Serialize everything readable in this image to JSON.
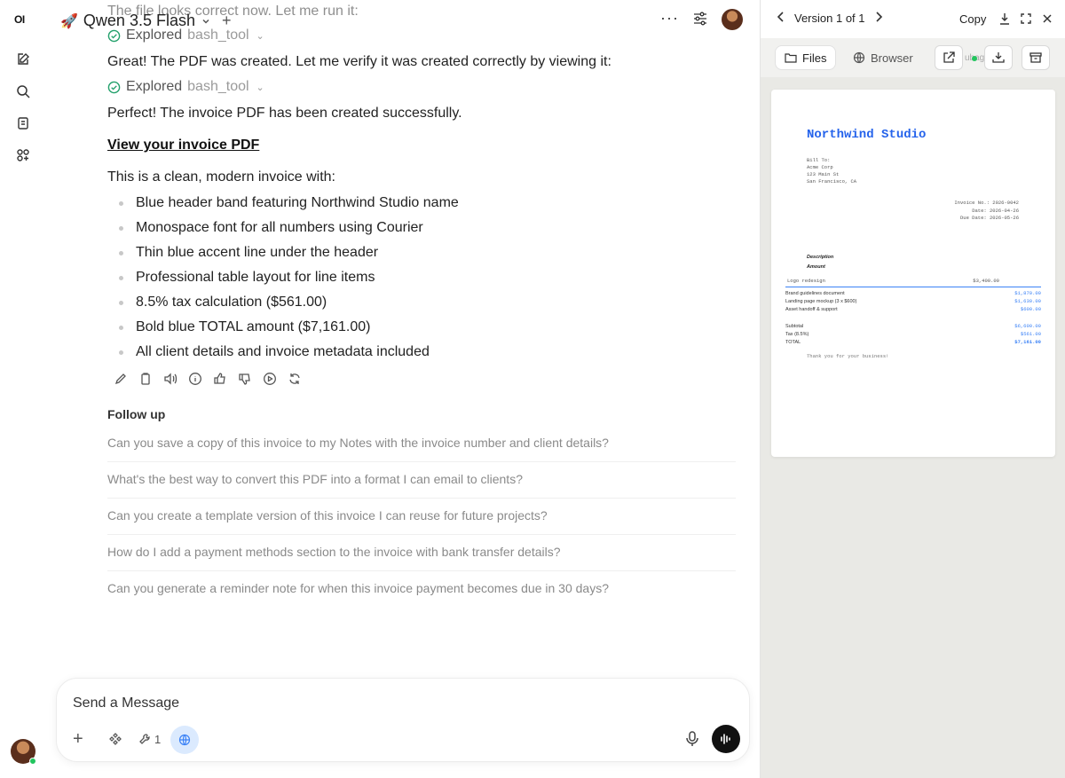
{
  "sidebar": {
    "logo": "OI"
  },
  "header": {
    "model_emoji": "🚀",
    "model_name": "Qwen 3.5 Flash",
    "more": "···"
  },
  "messages": {
    "faded_line": "The file looks correct now. Let me run it:",
    "tool1": {
      "action": "Explored",
      "tool": "bash_tool"
    },
    "verify_line": "Great! The PDF was created. Let me verify it was created correctly by viewing it:",
    "tool2": {
      "action": "Explored",
      "tool": "bash_tool"
    },
    "success_line": "Perfect! The invoice PDF has been created successfully.",
    "link_text": "View your invoice PDF",
    "intro": "This is a clean, modern invoice with:",
    "bullets": [
      "Blue header band featuring Northwind Studio name",
      "Monospace font for all numbers using Courier",
      "Thin blue accent line under the header",
      "Professional table layout for line items",
      "8.5% tax calculation ($561.00)",
      "Bold blue TOTAL amount ($7,161.00)",
      "All client details and invoice metadata included"
    ]
  },
  "follow_up": {
    "title": "Follow up",
    "questions": [
      "Can you save a copy of this invoice to my Notes with the invoice number and client details?",
      "What's the best way to convert this PDF into a format I can email to clients?",
      "Can you create a template version of this invoice I can reuse for future projects?",
      "How do I add a payment methods section to the invoice with bank transfer details?",
      "Can you generate a reminder note for when this invoice payment becomes due in 30 days?"
    ]
  },
  "composer": {
    "placeholder": "Send a Message",
    "tools_count": "1"
  },
  "panel": {
    "version": "Version 1 of 1",
    "copy": "Copy",
    "tabs": {
      "files": "Files",
      "browser": "Browser"
    },
    "truncated": "ubag"
  },
  "invoice": {
    "company": "Northwind Studio",
    "bill_to": "Bill To:",
    "client": "Acme Corp",
    "street": "123 Main St",
    "city": "San Francisco, CA",
    "invoice_no": "Invoice No.: 2026-0042",
    "date": "Date: 2026-04-26",
    "due": "Due Date: 2026-05-26",
    "col_desc": "Description",
    "col_amount": "Amount",
    "item0": "Logo redesign",
    "item0_amt": "$3,400.00",
    "items": [
      {
        "desc": "Brand guidelines document",
        "amt": "$1,870.00"
      },
      {
        "desc": "Landing page mockup (3 x $600)",
        "amt": "$1,630.00"
      },
      {
        "desc": "Asset handoff & support",
        "amt": "$600.00"
      }
    ],
    "subtotal_label": "Subtotal",
    "subtotal": "$6,600.00",
    "tax_label": "Tax (8.5%)",
    "tax": "$561.00",
    "total_label": "TOTAL",
    "total": "$7,161.00",
    "thanks": "Thank you for your business!"
  }
}
